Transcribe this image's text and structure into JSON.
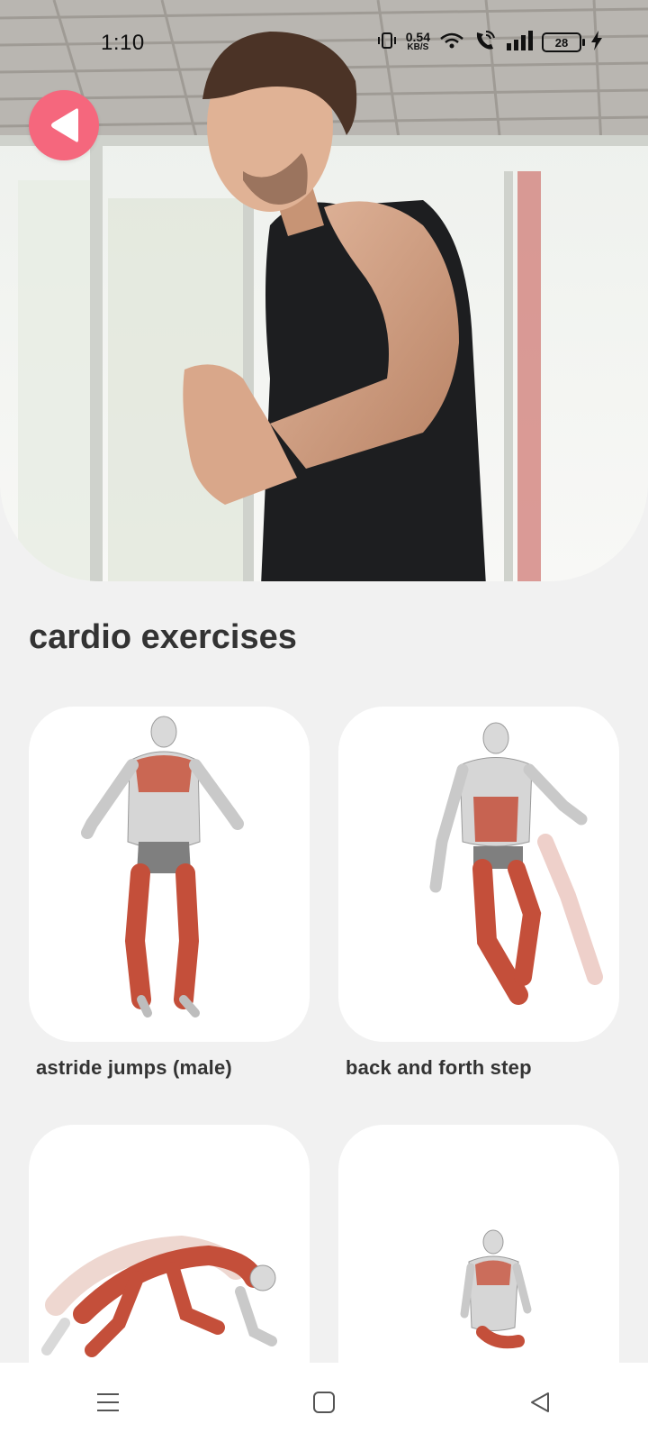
{
  "status_bar": {
    "time": "1:10",
    "net_speed_value": "0.54",
    "net_speed_unit": "KB/S",
    "battery_level": "28"
  },
  "page": {
    "title": "cardio exercises"
  },
  "exercises": [
    {
      "label": "astride jumps (male)"
    },
    {
      "label": "back and forth step"
    },
    {
      "label": ""
    },
    {
      "label": ""
    }
  ],
  "icons": {
    "back": "back-arrow-icon",
    "menu": "menu-icon",
    "home": "home-icon",
    "nav_back": "nav-back-icon"
  },
  "colors": {
    "accent": "#f5677d",
    "background": "#f1f1f1",
    "card": "#ffffff",
    "title_text": "#333333"
  }
}
